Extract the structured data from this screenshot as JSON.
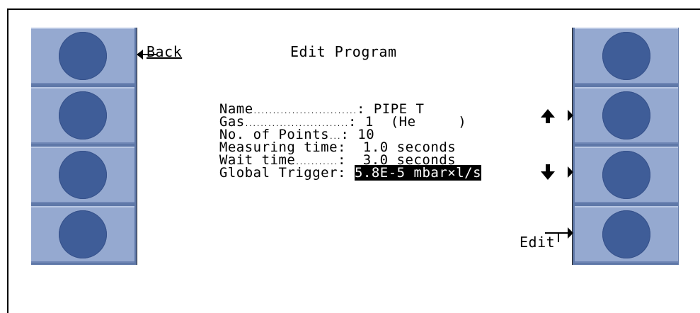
{
  "screen": {
    "title": "Edit Program",
    "back_label": "Back",
    "edit_label": "Edit",
    "fields": [
      {
        "label": "Name",
        "dots": "...........................",
        "value": "PIPE T"
      },
      {
        "label": "Gas",
        "dots": "...........................",
        "value": "1  (He     )"
      },
      {
        "label": "No. of Points",
        "dots": "...",
        "value": "10"
      },
      {
        "label": "Measuring time",
        "dots": "",
        "value": " 1.0 seconds"
      },
      {
        "label": "Wait time",
        "dots": "...........",
        "value": " 3.0 seconds"
      },
      {
        "label": "Global Trigger",
        "dots": "",
        "value": "5.8E-5 mbar×l/s"
      }
    ]
  },
  "icons": {
    "up": "arrow-up-icon",
    "down": "arrow-down-icon",
    "back": "back-arrow-icon",
    "edit": "edit-arrow-icon"
  },
  "colors": {
    "panel": "#5f78a8",
    "softkey": "#95a9d0",
    "softkey_circle": "#3f5d98"
  }
}
